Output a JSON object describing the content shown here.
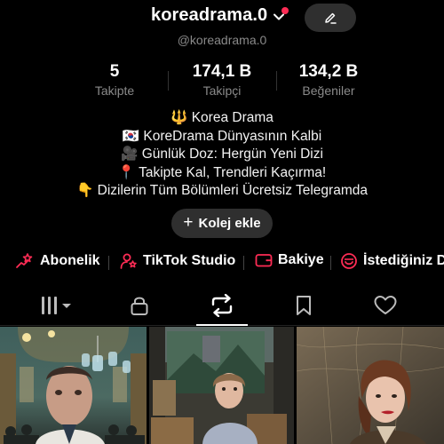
{
  "profile": {
    "username": "koreadrama.0",
    "handle": "@koreadrama.0"
  },
  "stats": [
    {
      "value": "5",
      "label": "Takipte"
    },
    {
      "value": "174,1 B",
      "label": "Takipçi"
    },
    {
      "value": "134,2 B",
      "label": "Beğeniler"
    }
  ],
  "bio": [
    "🔱 Korea Drama",
    "🇰🇷 KoreDrama Dünyasının Kalbi",
    "🎥 Günlük Doz: Hergün Yeni Dizi",
    "📍 Takipte Kal, Trendleri Kaçırma!",
    "👇 Dizilerin Tüm Bölümleri Ücretsiz Telegramda"
  ],
  "actions": {
    "add_collection": "Kolej ekle",
    "edit_icon": "pencil-icon"
  },
  "links": [
    {
      "label": "Abonelik",
      "icon": "star-hand-icon"
    },
    {
      "label": "TikTok Studio",
      "icon": "person-star-icon"
    },
    {
      "label": "Bakiye",
      "icon": "wallet-icon"
    },
    {
      "label": "İstediğiniz D",
      "icon": "smile-box-icon"
    }
  ],
  "tabs": [
    {
      "name": "videos",
      "icon": "grid-icon"
    },
    {
      "name": "private",
      "icon": "lock-icon"
    },
    {
      "name": "reposts",
      "icon": "repost-icon",
      "active": true
    },
    {
      "name": "saved",
      "icon": "bookmark-icon"
    },
    {
      "name": "liked",
      "icon": "heart-icon"
    }
  ],
  "colors": {
    "accent": "#fe2c55",
    "background": "#000000",
    "muted_text": "#8a8a8a",
    "button_bg": "#2f2f2f"
  }
}
